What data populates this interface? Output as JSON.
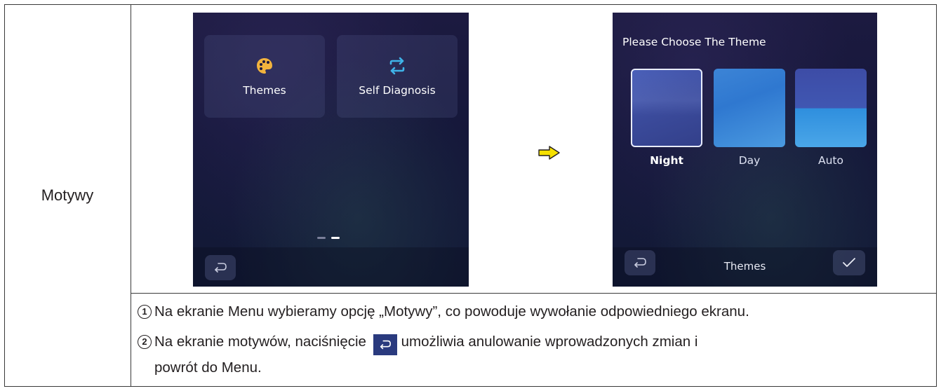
{
  "row_label": "Motywy",
  "menu_screen": {
    "tiles": [
      {
        "label": "Themes",
        "icon": "palette-icon"
      },
      {
        "label": "Self Diagnosis",
        "icon": "swap-arrows-icon"
      }
    ],
    "page_indicator": {
      "pages": 2,
      "active": 2
    }
  },
  "themes_screen": {
    "title": "Please Choose The Theme",
    "options": [
      {
        "label": "Night",
        "selected": true
      },
      {
        "label": "Day",
        "selected": false
      },
      {
        "label": "Auto",
        "selected": false
      }
    ],
    "bottom_title": "Themes"
  },
  "steps": [
    {
      "number": "1",
      "text": "Na ekranie Menu wybieramy opcję „Motywy”, co powoduje wywołanie odpowiedniego ekranu."
    },
    {
      "number": "2",
      "text_before": "Na ekranie motywów, naciśnięcie",
      "text_after": "umożliwia anulowanie wprowadzonych zmian i",
      "text_line2": "powrót do Menu."
    }
  ],
  "colors": {
    "arrow_fill": "#f5e000",
    "tile_icon_palette": "#f2b33d",
    "tile_icon_swap": "#3fb3e8",
    "inline_icon_bg": "#2a3a7e"
  }
}
